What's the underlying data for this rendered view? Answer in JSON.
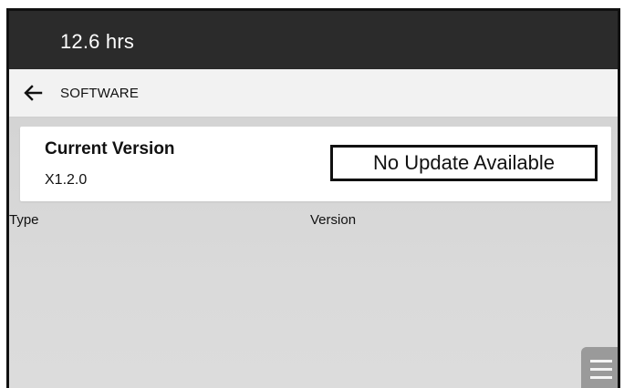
{
  "header": {
    "hours": "12.6 hrs"
  },
  "nav": {
    "back_icon": "arrow-left-icon",
    "title": "SOFTWARE"
  },
  "version_card": {
    "label": "Current Version",
    "value": "X1.2.0",
    "status": "No Update Available"
  },
  "table": {
    "columns": [
      "Type",
      "Version"
    ]
  },
  "menu": {
    "icon": "hamburger-menu-icon"
  },
  "colors": {
    "top_bar": "#2b2b2b",
    "nav_bar": "#f2f2f2",
    "content_bg": "#d9d9d9",
    "card_bg": "#ffffff",
    "menu_button": "#9a9a9a"
  }
}
